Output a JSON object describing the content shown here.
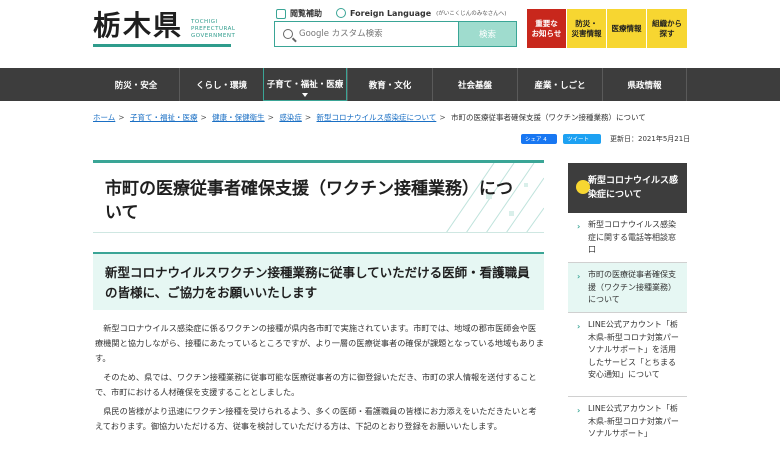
{
  "header": {
    "logo_kanji": "栃木県",
    "logo_en_1": "TOCHIGI",
    "logo_en_2": "PREFECTURAL",
    "logo_en_3": "GOVERNMENT",
    "util_reading": "閲覧補助",
    "util_foreign": "Foreign Language",
    "util_foreign_sub": "(がいこくじんのみなさんへ)",
    "search_placeholder": "Google カスタム検索",
    "search_button": "検索",
    "quick_buttons": [
      {
        "line1": "重要な",
        "line2": "お知らせ",
        "color": "#c8271c"
      },
      {
        "line1": "防災・",
        "line2": "災害情報",
        "color": "#f7d631"
      },
      {
        "line1": "医療情報",
        "line2": "",
        "color": "#f7d631"
      },
      {
        "line1": "組織から",
        "line2": "探す",
        "color": "#f7d631"
      }
    ]
  },
  "nav": {
    "items": [
      "防災・安全",
      "くらし・環境",
      "子育て・福祉・医療",
      "教育・文化",
      "社会基盤",
      "産業・しごと",
      "県政情報"
    ],
    "active_index": 2
  },
  "breadcrumb": {
    "links": [
      "ホーム",
      "子育て・福祉・医療",
      "健康・保健衛生",
      "感染症",
      "新型コロナウイルス感染症について"
    ],
    "current": "市町の医療従事者確保支援（ワクチン接種業務）について"
  },
  "share": {
    "facebook": "シェア 4",
    "twitter": "ツイート"
  },
  "updated": "更新日：2021年5月21日",
  "main": {
    "title": "市町の医療従事者確保支援（ワクチン接種業務）について",
    "subtitle": "新型コロナウイルスワクチン接種業務に従事していただける医師・看護職員の皆様に、ご協力をお願いいたします",
    "paragraphs": [
      "新型コロナウイルス感染症に係るワクチンの接種が県内各市町で実施されています。市町では、地域の郡市医師会や医療機関と協力しながら、接種にあたっているところですが、より一層の医療従事者の確保が課題となっている地域もあります。",
      "そのため、県では、ワクチン接種業務に従事可能な医療従事者の方に御登録いただき、市町の求人情報を送付することで、市町における人材確保を支援することとしました。",
      "県民の皆様がより迅速にワクチン接種を受けられるよう、多くの医師・看護職員の皆様にお力添えをいただきたいと考えております。御協力いただける方、従事を検討していただける方は、下記のとおり登録をお願いいたします。"
    ]
  },
  "sidebar": {
    "heading": "新型コロナウイルス感染症について",
    "items": [
      "新型コロナウイルス感染症に関する電話等相談窓口",
      "市町の医療従事者確保支援（ワクチン接種業務）について",
      "LINE公式アカウント「栃木県-新型コロナ対策パーソナルサポート」を活用したサービス「とちまる安心通知」について",
      "LINE公式アカウント「栃木県-新型コロナ対策パーソナルサポート」"
    ],
    "active_index": 1
  },
  "colors": {
    "accent": "#3aa596",
    "nav_bg": "#3d3d3d",
    "alert_red": "#c8271c",
    "alert_yellow": "#f7d631"
  }
}
